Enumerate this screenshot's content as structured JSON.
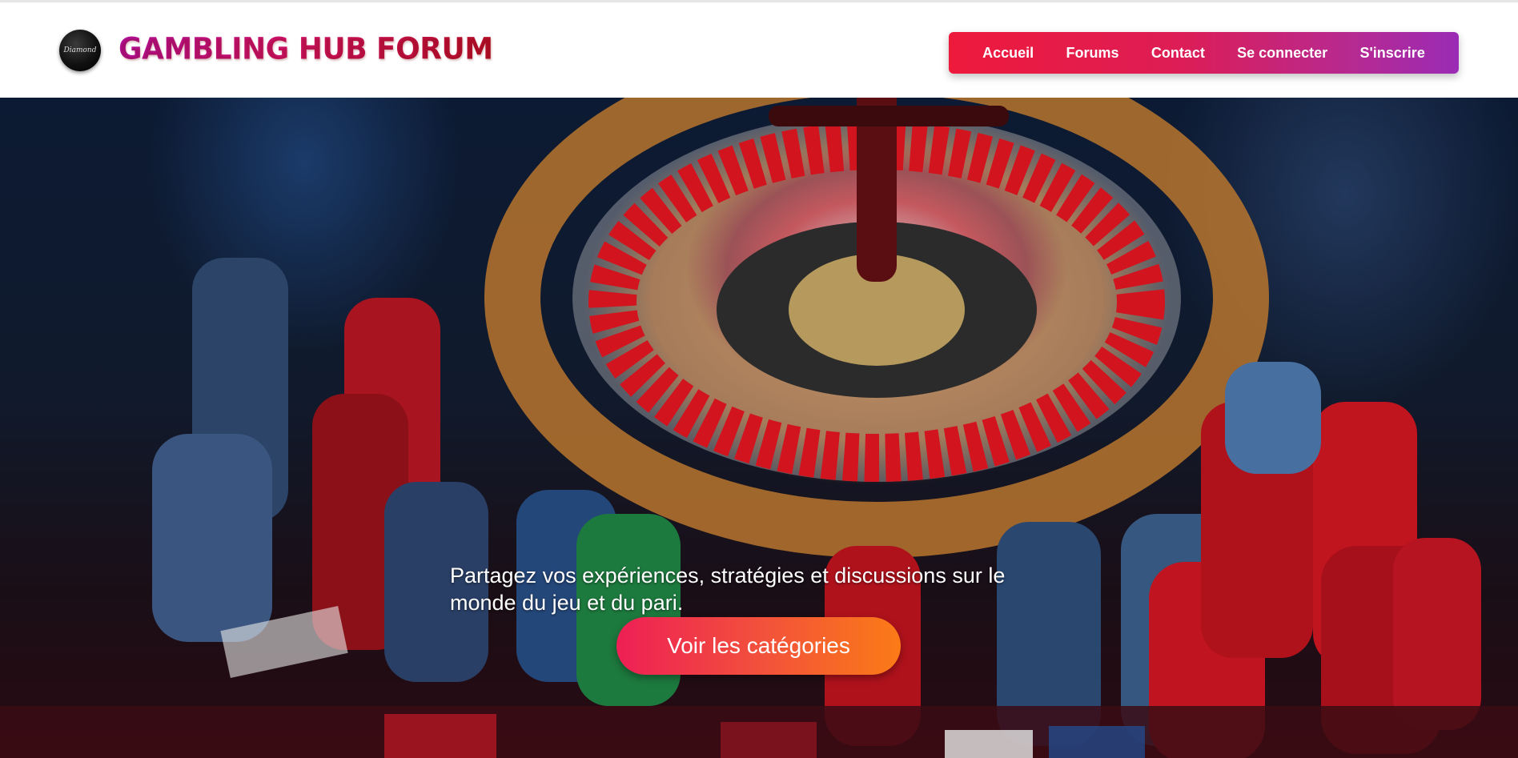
{
  "header": {
    "logo_text": "Diamond",
    "site_title": "GAMBLING HUB FORUM"
  },
  "nav": {
    "items": [
      "Accueil",
      "Forums",
      "Contact",
      "Se connecter",
      "S'inscrire"
    ]
  },
  "hero": {
    "tagline": "Partagez vos expériences, stratégies et discussions sur le monde du jeu et du pari.",
    "cta_label": "Voir les catégories"
  },
  "colors": {
    "nav_gradient_start": "#ee1a3c",
    "nav_gradient_end": "#9a2bb5",
    "title_gradient_start": "#b3129c",
    "title_gradient_end": "#b8102a",
    "cta_gradient_start": "#ee1f55",
    "cta_gradient_end": "#fb7b16"
  }
}
